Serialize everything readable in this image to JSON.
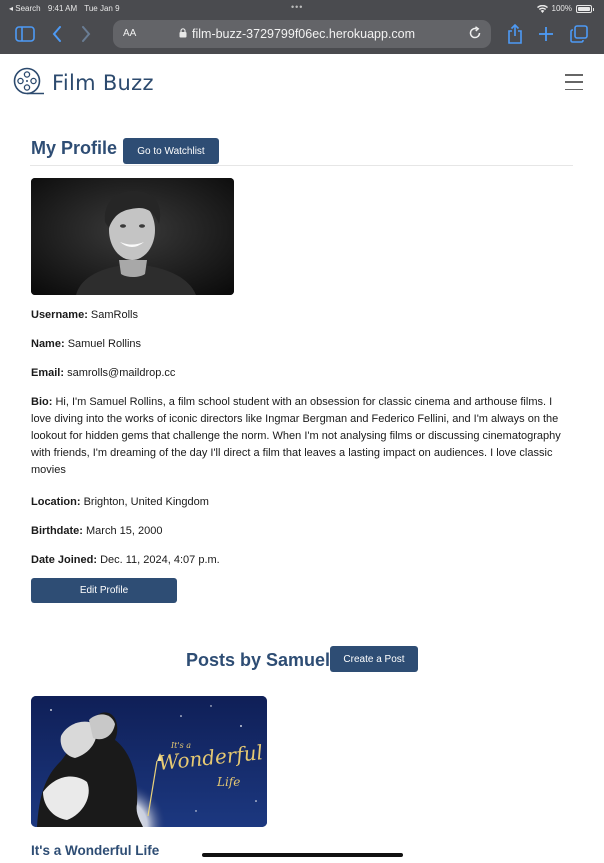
{
  "status_bar": {
    "back_label": "◂ Search",
    "time": "9:41 AM",
    "date": "Tue Jan 9",
    "battery": "100%"
  },
  "browser": {
    "text_size_label": "AA",
    "url": "film-buzz-3729799f06ec.herokuapp.com"
  },
  "navbar": {
    "brand": "Film Buzz"
  },
  "profile": {
    "title": "My Profile",
    "watchlist_button": "Go to Watchlist",
    "username_label": "Username:",
    "username": "SamRolls",
    "name_label": "Name:",
    "name": "Samuel Rollins",
    "email_label": "Email:",
    "email": "samrolls@maildrop.cc",
    "bio_label": "Bio:",
    "bio": "Hi, I'm Samuel Rollins, a film school student with an obsession for classic cinema and arthouse films. I love diving into the works of iconic directors like Ingmar Bergman and Federico Fellini, and I'm always on the lookout for hidden gems that challenge the norm. When I'm not analysing films or discussing cinematography with friends, I'm dreaming of the day I'll direct a film that leaves a lasting impact on audiences. I love classic movies",
    "location_label": "Location:",
    "location": "Brighton, United Kingdom",
    "birthdate_label": "Birthdate:",
    "birthdate": "March 15, 2000",
    "joined_label": "Date Joined:",
    "joined": "Dec. 11, 2024, 4:07 p.m.",
    "edit_button": "Edit Profile"
  },
  "posts": {
    "title": "Posts by Samuel",
    "create_button": "Create a Post",
    "items": [
      {
        "title": "It's a Wonderful Life",
        "poster_text_small": "It's a",
        "poster_text_big": "Wonderful",
        "poster_text_end": "Life"
      }
    ]
  },
  "colors": {
    "brand": "#2e4d74",
    "browser_chrome": "#4a4b4f",
    "browser_accent": "#4d9af5"
  }
}
